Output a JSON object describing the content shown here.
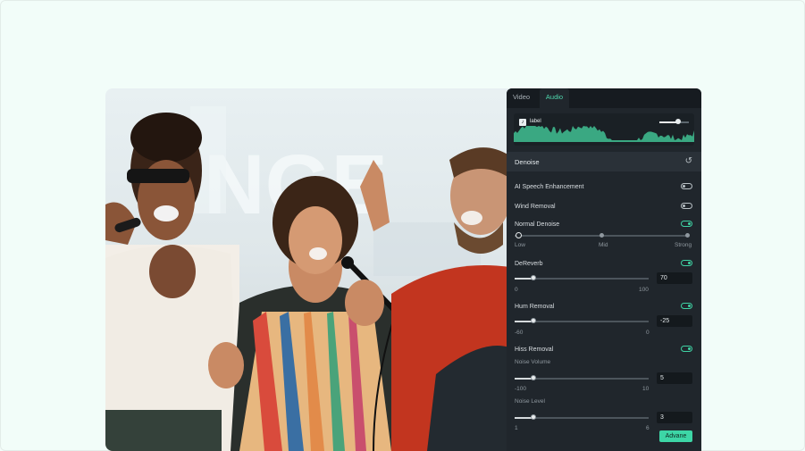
{
  "tabs": {
    "video": "Video",
    "audio": "Audio",
    "active": "Audio"
  },
  "waveform": {
    "clip_label": "label",
    "volume_level": 0.65,
    "accent": "#3aa882"
  },
  "denoise": {
    "title": "Denoise",
    "ai_speech_enhancement": {
      "label": "AI Speech Enhancement",
      "enabled": false
    },
    "wind_removal": {
      "label": "Wind Removal",
      "enabled": false
    },
    "normal_denoise": {
      "label": "Normal Denoise",
      "enabled": true,
      "levels": [
        "Low",
        "Mid",
        "Strong"
      ],
      "selected": "Low"
    },
    "dereverb": {
      "label": "DeReverb",
      "enabled": true,
      "value": "70",
      "min": "0",
      "max": "100",
      "level": 0.14
    },
    "hum_removal": {
      "label": "Hum Removal",
      "enabled": true,
      "value": "-25",
      "min": "-60",
      "max": "0",
      "level": 0.14
    },
    "hiss_removal": {
      "label": "Hiss Removal",
      "enabled": true,
      "noise_volume": {
        "label": "Noise Volume",
        "value": "5",
        "min": "-100",
        "max": "10",
        "level": 0.14
      },
      "noise_level": {
        "label": "Noise Level",
        "value": "3",
        "min": "1",
        "max": "6",
        "level": 0.14
      }
    }
  },
  "advance_button": "Advane",
  "colors": {
    "accent": "#3dd6a6",
    "panel_bg": "#20262c",
    "page_bg": "#f2fdf9"
  }
}
